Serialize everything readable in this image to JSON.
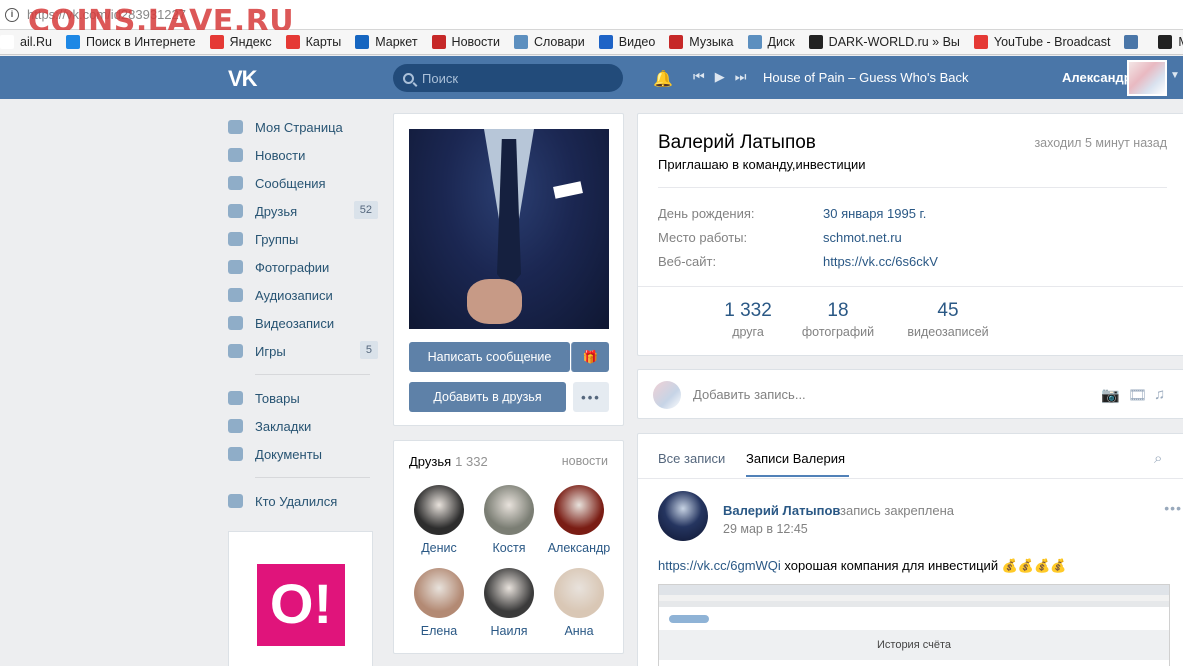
{
  "browser": {
    "url": "https://vk.com/id283931227",
    "watermark": "COINS.LAVE.RU",
    "bookmarks": [
      {
        "label": "ail.Ru",
        "icon": "mail-icon",
        "color": "#ffffff"
      },
      {
        "label": "Поиск в Интернете",
        "icon": "search-icon",
        "color": "#1e88e5"
      },
      {
        "label": "Яндекс",
        "icon": "yandex-icon",
        "color": "#e53935"
      },
      {
        "label": "Карты",
        "icon": "map-pin-icon",
        "color": "#e53935"
      },
      {
        "label": "Маркет",
        "icon": "cart-icon",
        "color": "#1565c0"
      },
      {
        "label": "Новости",
        "icon": "news-icon",
        "color": "#c62828"
      },
      {
        "label": "Словари",
        "icon": "dictionary-icon",
        "color": "#5c8fbf"
      },
      {
        "label": "Видео",
        "icon": "video-icon",
        "color": "#1e63c6"
      },
      {
        "label": "Музыка",
        "icon": "music-icon",
        "color": "#c62828"
      },
      {
        "label": "Диск",
        "icon": "disk-icon",
        "color": "#5c8fbf"
      },
      {
        "label": "DARK-WORLD.ru » Вы",
        "icon": "skull-icon",
        "color": "#222222"
      },
      {
        "label": "YouTube - Broadcast",
        "icon": "youtube-icon",
        "color": "#e53935"
      },
      {
        "label": "",
        "icon": "vk-icon",
        "color": "#4a76a8"
      },
      {
        "label": "MetalArea - Ex",
        "icon": "metalarea-icon",
        "color": "#222222"
      }
    ]
  },
  "header": {
    "logo": "VK",
    "search_placeholder": "Поиск",
    "track": "House of Pain – Guess Who's Back",
    "username": "Александр"
  },
  "nav": {
    "items": [
      {
        "label": "Моя Страница",
        "badge": ""
      },
      {
        "label": "Новости",
        "badge": ""
      },
      {
        "label": "Сообщения",
        "badge": ""
      },
      {
        "label": "Друзья",
        "badge": "52"
      },
      {
        "label": "Группы",
        "badge": ""
      },
      {
        "label": "Фотографии",
        "badge": ""
      },
      {
        "label": "Аудиозаписи",
        "badge": ""
      },
      {
        "label": "Видеозаписи",
        "badge": ""
      },
      {
        "label": "Игры",
        "badge": "5"
      }
    ],
    "items2": [
      {
        "label": "Товары"
      },
      {
        "label": "Закладки"
      },
      {
        "label": "Документы"
      }
    ],
    "items3": [
      {
        "label": "Кто Удалился"
      }
    ],
    "ad_logo": "O!"
  },
  "profile": {
    "write_message": "Написать сообщение",
    "add_friend": "Добавить в друзья",
    "more": "•••",
    "name": "Валерий Латыпов",
    "status": "Приглашаю в команду,инвестиции",
    "online": "заходил 5 минут назад",
    "info": [
      {
        "label": "День рождения:",
        "value": "30 января 1995 г."
      },
      {
        "label": "Место работы:",
        "value": "schmot.net.ru"
      },
      {
        "label": "Веб-сайт:",
        "value": "https://vk.cc/6s6ckV"
      }
    ],
    "counters": [
      {
        "num": "1 332",
        "label": "друга"
      },
      {
        "num": "18",
        "label": "фотографий"
      },
      {
        "num": "45",
        "label": "видеозаписей"
      }
    ]
  },
  "friends": {
    "title": "Друзья",
    "count": "1 332",
    "news": "новости",
    "list": [
      {
        "name": "Денис",
        "color": "#2d2d2d"
      },
      {
        "name": "Костя",
        "color": "#7b7e74"
      },
      {
        "name": "Александр",
        "color": "#7a1d14"
      },
      {
        "name": "Елена",
        "color": "#b38a74"
      },
      {
        "name": "Наиля",
        "color": "#3b3b3b"
      },
      {
        "name": "Анна",
        "color": "#d9c7b5"
      }
    ]
  },
  "composer": {
    "placeholder": "Добавить запись..."
  },
  "wall": {
    "tabs": [
      "Все записи",
      "Записи Валерия"
    ],
    "post": {
      "author": "Валерий Латыпов",
      "pinned": "запись закреплена",
      "date": "29 мар в 12:45",
      "link": "https://vk.cc/6gmWQi",
      "text": " хорошая компания для инвестиций",
      "emoji": "💰💰💰💰",
      "more": "•••",
      "screenshot_caption": "История счёта"
    }
  }
}
